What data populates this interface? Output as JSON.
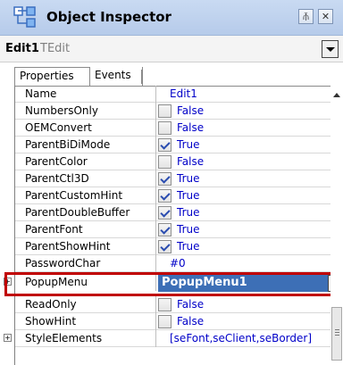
{
  "window": {
    "title": "Object Inspector",
    "pin_glyph": "⫚",
    "close_glyph": "✕"
  },
  "component": {
    "name": "Edit1",
    "type": "TEdit"
  },
  "tabs": [
    {
      "label": "Properties",
      "active": true
    },
    {
      "label": "Events",
      "active": false
    }
  ],
  "properties": [
    {
      "name": "Name",
      "value": "Edit1",
      "checkbox": null,
      "expandable": false
    },
    {
      "name": "NumbersOnly",
      "value": "False",
      "checkbox": false,
      "expandable": false
    },
    {
      "name": "OEMConvert",
      "value": "False",
      "checkbox": false,
      "expandable": false
    },
    {
      "name": "ParentBiDiMode",
      "value": "True",
      "checkbox": true,
      "expandable": false
    },
    {
      "name": "ParentColor",
      "value": "False",
      "checkbox": false,
      "expandable": false
    },
    {
      "name": "ParentCtl3D",
      "value": "True",
      "checkbox": true,
      "expandable": false
    },
    {
      "name": "ParentCustomHint",
      "value": "True",
      "checkbox": true,
      "expandable": false
    },
    {
      "name": "ParentDoubleBuffer",
      "value": "True",
      "checkbox": true,
      "expandable": false
    },
    {
      "name": "ParentFont",
      "value": "True",
      "checkbox": true,
      "expandable": false
    },
    {
      "name": "ParentShowHint",
      "value": "True",
      "checkbox": true,
      "expandable": false
    },
    {
      "name": "PasswordChar",
      "value": "#0",
      "checkbox": null,
      "expandable": false
    },
    {
      "name": "PopupMenu",
      "value": "PopupMenu1",
      "checkbox": null,
      "expandable": true,
      "selected": true
    },
    {
      "name": "ReadOnly",
      "value": "False",
      "checkbox": false,
      "expandable": false
    },
    {
      "name": "ShowHint",
      "value": "False",
      "checkbox": false,
      "expandable": false
    },
    {
      "name": "StyleElements",
      "value": "[seFont,seClient,seBorder]",
      "checkbox": null,
      "expandable": true
    }
  ],
  "colors": {
    "value_text": "#0000c8",
    "selection_bg": "#3d6fb6",
    "highlight_box": "#c00000",
    "titlebar": "#c9daf2"
  },
  "icons": {
    "title": "object-inspector-icon",
    "expand": "plus-icon",
    "checkbox_checked": "check-icon"
  }
}
